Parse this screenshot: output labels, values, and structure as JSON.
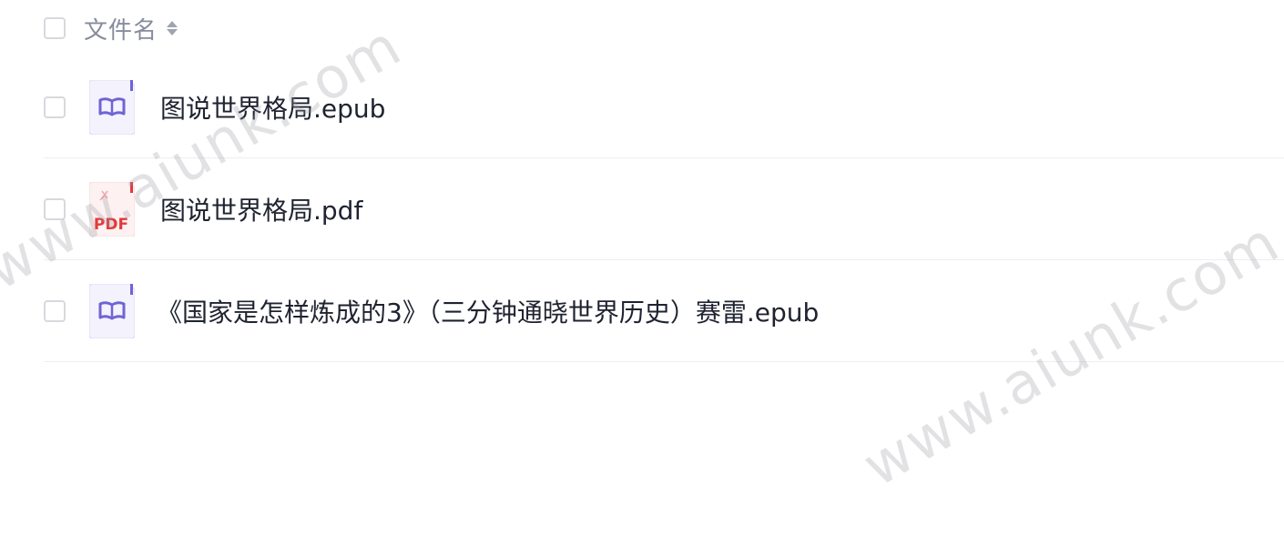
{
  "header": {
    "title": "文件名",
    "sort_icon": "sort-caret-icon"
  },
  "files": [
    {
      "name": "图说世界格局.epub",
      "icon": "epub-book-icon",
      "type": "epub"
    },
    {
      "name": "图说世界格局.pdf",
      "icon": "pdf-file-icon",
      "type": "pdf",
      "icon_label": "PDF"
    },
    {
      "name": "《国家是怎样炼成的3》（三分钟通晓世界历史）赛雷.epub",
      "icon": "epub-book-icon",
      "type": "epub"
    }
  ],
  "watermarks": [
    "www.aiunk.com",
    "www.aiunk.com"
  ],
  "colors": {
    "epub_accent": "#6e64d6",
    "pdf_accent": "#e4393c",
    "checkbox_border": "#d8d9de",
    "divider": "#eceef2",
    "text_primary": "#1f2330",
    "text_secondary": "#878c9c"
  }
}
